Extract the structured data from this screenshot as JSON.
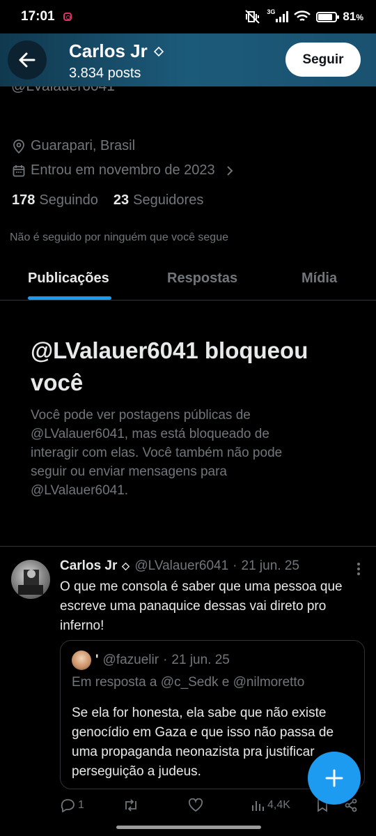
{
  "status_bar": {
    "time": "17:01",
    "network": "3G",
    "battery": "81",
    "battery_suffix": "%",
    "battery_level": 0.81
  },
  "header": {
    "name": "Carlos Jr",
    "posts": "3.834 posts",
    "follow_label": "Seguir",
    "gradient_colors": [
      "#10394f",
      "#1c5a7a"
    ]
  },
  "profile": {
    "handle_cut": "@LValauer6041",
    "location": "Guarapari, Brasil",
    "joined": "Entrou em novembro de 2023",
    "following_count": "178",
    "following_label": "Seguindo",
    "followers_count": "23",
    "followers_label": "Seguidores",
    "not_followed": "Não é seguido por ninguém que você segue"
  },
  "tabs": [
    {
      "label": "Publicações",
      "active": true
    },
    {
      "label": "Respostas",
      "active": false
    },
    {
      "label": "Mídia",
      "active": false
    }
  ],
  "blocked": {
    "title": "@LValauer6041 bloqueou você",
    "description": "Você pode ver postagens públicas de @LValauer6041, mas está bloqueado de interagir com elas. Você também não pode seguir ou enviar mensagens para @LValauer6041."
  },
  "tweet": {
    "name": "Carlos Jr",
    "handle": "@LValauer6041",
    "separator": "·",
    "date": "21 jun. 25",
    "text": "O que me consola é saber que uma pessoa que escreve uma panaquice dessas vai direto pro inferno!",
    "quote": {
      "name": "'",
      "handle": "@fazuelir",
      "separator": "·",
      "date": "21 jun. 25",
      "reply_to": "Em resposta a @c_Sedk e @nilmoretto",
      "text": "Se ela for honesta, ela sabe que não existe genocídio em Gaza e que isso não passa de uma propaganda neonazista pra justificar perseguição a judeus."
    },
    "actions": {
      "replies": "1",
      "views": "4,4K"
    }
  },
  "colors": {
    "accent": "#1d9bf0",
    "muted_text": "#71767b",
    "primary_text": "#e7e9ea",
    "border": "#2f3336"
  },
  "icons": [
    "back-arrow-icon",
    "verified-diamond-icon",
    "location-pin-icon",
    "calendar-icon",
    "chevron-right-icon",
    "more-vertical-icon",
    "reply-icon",
    "retweet-icon",
    "like-icon",
    "views-icon",
    "bookmark-icon",
    "share-icon",
    "plus-icon"
  ]
}
